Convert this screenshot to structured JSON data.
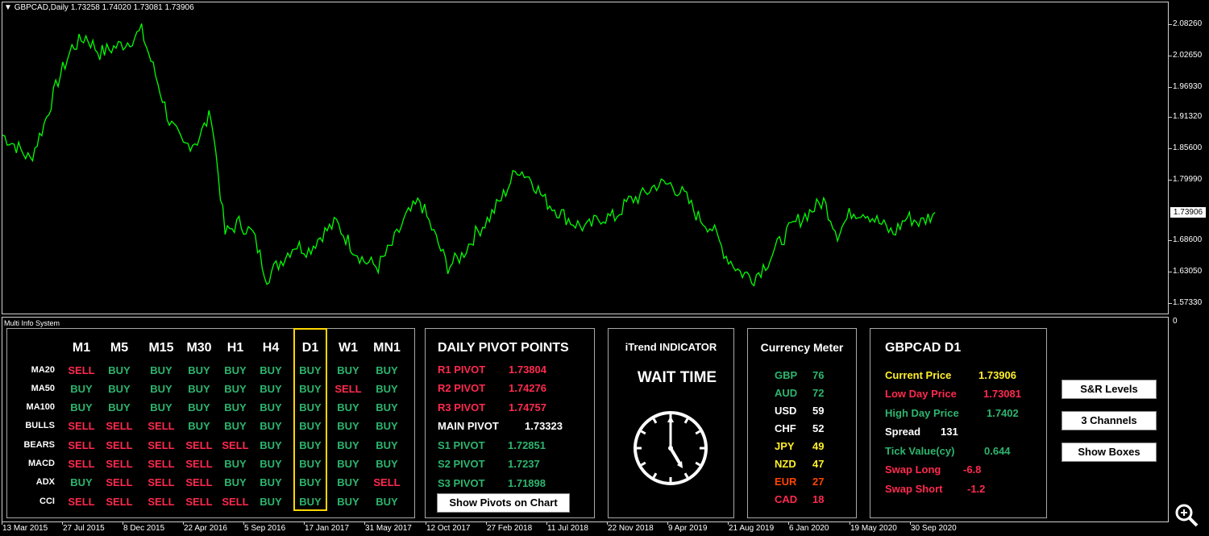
{
  "chart": {
    "title": "GBPCAD,Daily  1.73258 1.74020 1.73081 1.73906",
    "current_price_label": "1.73906",
    "line_color": "#00ff00",
    "y_ticks": [
      "2.08260",
      "2.02650",
      "1.96930",
      "1.91320",
      "1.85600",
      "1.79990",
      "1.68600",
      "1.63050",
      "1.57330"
    ],
    "x_ticks": [
      "13 Mar 2015",
      "27 Jul 2015",
      "8 Dec 2015",
      "22 Apr 2016",
      "5 Sep 2016",
      "17 Jan 2017",
      "31 May 2017",
      "12 Oct 2017",
      "27 Feb 2018",
      "11 Jul 2018",
      "22 Nov 2018",
      "9 Apr 2019",
      "21 Aug 2019",
      "6 Jan 2020",
      "19 May 2020",
      "30 Sep 2020"
    ]
  },
  "chart_data": {
    "type": "line",
    "title": "GBPCAD,Daily",
    "x_start": "13 Mar 2015",
    "x_end": "Oct 2020",
    "ylim": [
      1.5733,
      2.0826
    ],
    "series": [
      {
        "name": "GBPCAD",
        "x": [
          "Mar 2015",
          "Apr 2015",
          "May 2015",
          "Jun 2015",
          "Jul 2015",
          "Aug 2015",
          "Sep 2015",
          "Oct 2015",
          "Nov 2015",
          "Dec 2015",
          "Jan 2016",
          "Feb 2016",
          "Mar 2016",
          "Apr 2016",
          "May 2016",
          "Jun 2016",
          "Jul 2016",
          "Aug 2016",
          "Sep 2016",
          "Oct 2016",
          "Nov 2016",
          "Dec 2016",
          "Jan 2017",
          "Feb 2017",
          "Mar 2017",
          "Apr 2017",
          "May 2017",
          "Jun 2017",
          "Jul 2017",
          "Aug 2017",
          "Sep 2017",
          "Oct 2017",
          "Nov 2017",
          "Dec 2017",
          "Jan 2018",
          "Feb 2018",
          "Mar 2018",
          "Apr 2018",
          "May 2018",
          "Jun 2018",
          "Jul 2018",
          "Aug 2018",
          "Sep 2018",
          "Oct 2018",
          "Nov 2018",
          "Dec 2018",
          "Jan 2019",
          "Feb 2019",
          "Mar 2019",
          "Apr 2019",
          "May 2019",
          "Jun 2019",
          "Jul 2019",
          "Aug 2019",
          "Sep 2019",
          "Oct 2019",
          "Nov 2019",
          "Dec 2019",
          "Jan 2020",
          "Feb 2020",
          "Mar 2020",
          "Apr 2020",
          "May 2020",
          "Jun 2020",
          "Jul 2020",
          "Aug 2020",
          "Sep 2020",
          "Oct 2020"
        ],
        "values": [
          1.88,
          1.86,
          1.835,
          1.9,
          1.98,
          2.04,
          2.06,
          2.03,
          2.04,
          2.05,
          2.07,
          1.99,
          1.905,
          1.86,
          1.87,
          1.92,
          1.7,
          1.72,
          1.7,
          1.62,
          1.65,
          1.68,
          1.67,
          1.7,
          1.72,
          1.68,
          1.65,
          1.64,
          1.68,
          1.73,
          1.76,
          1.7,
          1.64,
          1.66,
          1.7,
          1.73,
          1.77,
          1.82,
          1.8,
          1.76,
          1.74,
          1.72,
          1.71,
          1.73,
          1.73,
          1.76,
          1.77,
          1.79,
          1.79,
          1.77,
          1.73,
          1.71,
          1.66,
          1.63,
          1.62,
          1.65,
          1.69,
          1.72,
          1.74,
          1.76,
          1.7,
          1.74,
          1.74,
          1.72,
          1.7,
          1.73,
          1.72,
          1.739
        ]
      }
    ]
  },
  "subwindow": {
    "title": "Multi Info System",
    "zero_label": "0"
  },
  "signals": {
    "timeframes": [
      "M1",
      "M5",
      "M15",
      "M30",
      "H1",
      "H4",
      "D1",
      "W1",
      "MN1"
    ],
    "rows": [
      {
        "label": "MA20",
        "values": [
          "SELL",
          "BUY",
          "BUY",
          "BUY",
          "BUY",
          "BUY",
          "BUY",
          "BUY",
          "BUY"
        ]
      },
      {
        "label": "MA50",
        "values": [
          "BUY",
          "BUY",
          "BUY",
          "BUY",
          "BUY",
          "BUY",
          "BUY",
          "SELL",
          "BUY"
        ]
      },
      {
        "label": "MA100",
        "values": [
          "BUY",
          "BUY",
          "BUY",
          "BUY",
          "BUY",
          "BUY",
          "BUY",
          "BUY",
          "BUY"
        ]
      },
      {
        "label": "BULLS",
        "values": [
          "SELL",
          "SELL",
          "SELL",
          "BUY",
          "BUY",
          "BUY",
          "BUY",
          "BUY",
          "BUY"
        ]
      },
      {
        "label": "BEARS",
        "values": [
          "SELL",
          "SELL",
          "SELL",
          "SELL",
          "SELL",
          "BUY",
          "BUY",
          "BUY",
          "BUY"
        ]
      },
      {
        "label": "MACD",
        "values": [
          "SELL",
          "SELL",
          "SELL",
          "SELL",
          "BUY",
          "BUY",
          "BUY",
          "BUY",
          "BUY"
        ]
      },
      {
        "label": "ADX",
        "values": [
          "BUY",
          "SELL",
          "SELL",
          "SELL",
          "BUY",
          "BUY",
          "BUY",
          "BUY",
          "SELL"
        ]
      },
      {
        "label": "CCI",
        "values": [
          "SELL",
          "SELL",
          "SELL",
          "SELL",
          "SELL",
          "BUY",
          "BUY",
          "BUY",
          "BUY"
        ]
      }
    ]
  },
  "pivots": {
    "title": "DAILY PIVOT POINTS",
    "items": [
      {
        "label": "R1 PIVOT",
        "value": "1.73804",
        "color": "sell"
      },
      {
        "label": "R2 PIVOT",
        "value": "1.74276",
        "color": "sell"
      },
      {
        "label": "R3 PIVOT",
        "value": "1.74757",
        "color": "sell"
      },
      {
        "label": "MAIN PIVOT",
        "value": "1.73323",
        "color": "white"
      },
      {
        "label": "S1 PIVOT",
        "value": "1.72851",
        "color": "buy"
      },
      {
        "label": "S2 PIVOT",
        "value": "1.7237",
        "color": "buy"
      },
      {
        "label": "S3 PIVOT",
        "value": "1.71898",
        "color": "buy"
      }
    ],
    "show_button": "Show Pivots on Chart"
  },
  "itrend": {
    "title": "iTrend INDICATOR",
    "status": "WAIT TIME"
  },
  "currency_meter": {
    "title": "Currency Meter",
    "items": [
      {
        "code": "GBP",
        "value": "76",
        "color": "buy"
      },
      {
        "code": "AUD",
        "value": "72",
        "color": "buy"
      },
      {
        "code": "USD",
        "value": "59",
        "color": "white"
      },
      {
        "code": "CHF",
        "value": "52",
        "color": "white"
      },
      {
        "code": "JPY",
        "value": "49",
        "color": "yellow"
      },
      {
        "code": "NZD",
        "value": "47",
        "color": "yellow"
      },
      {
        "code": "EUR",
        "value": "27",
        "color": "orange"
      },
      {
        "code": "CAD",
        "value": "18",
        "color": "sell"
      }
    ]
  },
  "info": {
    "title": "GBPCAD D1",
    "items": [
      {
        "label": "Current Price",
        "value": "1.73906",
        "color": "yellow"
      },
      {
        "label": "Low Day Price",
        "value": "1.73081",
        "color": "sell"
      },
      {
        "label": "High Day Price",
        "value": "1.7402",
        "color": "buy"
      },
      {
        "label": "Spread",
        "value": "131",
        "color": "white"
      },
      {
        "label": "Tick Value(cy)",
        "value": "0.644",
        "color": "buy"
      },
      {
        "label": "Swap Long",
        "value": "-6.8",
        "color": "sell"
      },
      {
        "label": "Swap Short",
        "value": "-1.2",
        "color": "sell"
      }
    ]
  },
  "buttons": {
    "sr_levels": "S&R Levels",
    "channels": "3 Channels",
    "show_boxes": "Show Boxes"
  },
  "colors": {
    "sell": "#ff2a4e",
    "buy": "#2db56e",
    "highlight": "#ffd700",
    "price_line": "#00ff00"
  }
}
